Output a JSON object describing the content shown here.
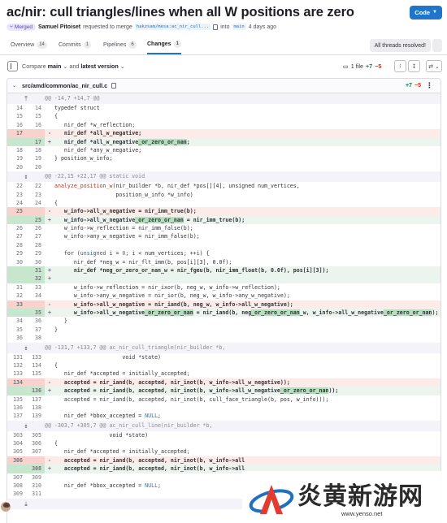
{
  "header": {
    "title": "ac/nir: cull triangles/lines when all W positions are zero",
    "code_button": "Code"
  },
  "meta": {
    "status": "Merged",
    "author": "Samuel Pitoiset",
    "action": "requested to merge",
    "source_branch": "hakzsam/mesa:ac_nir_cull...",
    "into": "into",
    "target_branch": "main",
    "time": "4 days ago"
  },
  "tabs": [
    {
      "label": "Overview",
      "count": "14"
    },
    {
      "label": "Commits",
      "count": "1"
    },
    {
      "label": "Pipelines",
      "count": "6"
    },
    {
      "label": "Changes",
      "count": "1"
    }
  ],
  "threads_button": "All threads resolved!",
  "toolbar": {
    "compare_label": "Compare",
    "base": "main",
    "and_label": "and",
    "head": "latest version",
    "files_count": "1 file",
    "additions": "+7",
    "deletions": "−5"
  },
  "file": {
    "path": "src/amd/common/ac_nir_cull.c",
    "additions": "+7",
    "deletions": "−5"
  },
  "colors": {
    "accent": "#1f75cb",
    "added": "#108548",
    "removed": "#dd2b0e"
  },
  "diff": [
    {
      "t": "hunk",
      "text": "@@ -14,7 +14,7 @@",
      "icon": "up"
    },
    {
      "t": "ctx",
      "o": "14",
      "n": "14",
      "code": [
        [
          "typedef struct",
          ""
        ]
      ]
    },
    {
      "t": "ctx",
      "o": "15",
      "n": "15",
      "code": [
        [
          "{",
          ""
        ]
      ]
    },
    {
      "t": "ctx",
      "o": "16",
      "n": "16",
      "code": [
        [
          "   nir_def *w_reflection;",
          ""
        ]
      ]
    },
    {
      "t": "del",
      "o": "17",
      "n": "",
      "code": [
        [
          "   nir_def *all_w_negative;",
          ""
        ]
      ]
    },
    {
      "t": "add",
      "o": "",
      "n": "17",
      "code": [
        [
          "   nir_def *all_w_negative",
          ""
        ],
        [
          "_or_zero_or_nan",
          "hl-a"
        ],
        [
          ";",
          ""
        ]
      ]
    },
    {
      "t": "ctx",
      "o": "18",
      "n": "18",
      "code": [
        [
          "   nir_def *any_w_negative;",
          ""
        ]
      ]
    },
    {
      "t": "ctx",
      "o": "19",
      "n": "19",
      "code": [
        [
          "} position_w_info;",
          ""
        ]
      ]
    },
    {
      "t": "ctx",
      "o": "20",
      "n": "20",
      "code": [
        [
          "",
          ""
        ]
      ]
    },
    {
      "t": "hunk",
      "text": "@@ -22,15 +22,17 @@ static void",
      "icon": "both"
    },
    {
      "t": "ctx",
      "o": "22",
      "n": "22",
      "code": [
        [
          "analyze_position_w",
          "fn"
        ],
        [
          "(nir_builder *b, nir_def *pos[][4], unsigned num_vertices,",
          ""
        ]
      ]
    },
    {
      "t": "ctx",
      "o": "23",
      "n": "23",
      "code": [
        [
          "                   position_w_info *w_info)",
          ""
        ]
      ]
    },
    {
      "t": "ctx",
      "o": "24",
      "n": "24",
      "code": [
        [
          "{",
          ""
        ]
      ]
    },
    {
      "t": "del",
      "o": "25",
      "n": "",
      "code": [
        [
          "   w_info->all_w_negative = nir_imm_true(b);",
          ""
        ]
      ]
    },
    {
      "t": "add",
      "o": "",
      "n": "25",
      "code": [
        [
          "   w_info->all_w_negative",
          ""
        ],
        [
          "_or_zero_or_nan",
          "hl-a"
        ],
        [
          " = nir_imm_true(b);",
          ""
        ]
      ]
    },
    {
      "t": "ctx",
      "o": "26",
      "n": "26",
      "code": [
        [
          "   w_info->w_reflection = nir_imm_false(b);",
          ""
        ]
      ]
    },
    {
      "t": "ctx",
      "o": "27",
      "n": "27",
      "code": [
        [
          "   w_info->any_w_negative = nir_imm_false(b);",
          ""
        ]
      ]
    },
    {
      "t": "ctx",
      "o": "28",
      "n": "28",
      "code": [
        [
          "",
          ""
        ]
      ]
    },
    {
      "t": "ctx",
      "o": "29",
      "n": "29",
      "code": [
        [
          "   for (",
          ""
        ],
        [
          "unsigned",
          "kw"
        ],
        [
          " i = ",
          ""
        ],
        [
          "0",
          "nm"
        ],
        [
          "; i < num_vertices; ++i) {",
          ""
        ]
      ]
    },
    {
      "t": "ctx",
      "o": "30",
      "n": "30",
      "code": [
        [
          "      nir_def *neg_w = nir_flt_imm(b, pos[i][3], 0.0f);",
          ""
        ]
      ]
    },
    {
      "t": "add",
      "o": "",
      "n": "31",
      "code": [
        [
          "      nir_def *neg_or_zero_or_nan_w = nir_fgeu(b, nir_imm_float(b, 0.0f), pos[i][3]);",
          ""
        ]
      ]
    },
    {
      "t": "add",
      "o": "",
      "n": "32",
      "code": [
        [
          "",
          ""
        ]
      ]
    },
    {
      "t": "ctx",
      "o": "31",
      "n": "33",
      "code": [
        [
          "      w_info->w_reflection = nir_ixor(b, neg_w, w_info->w_reflection);",
          ""
        ]
      ]
    },
    {
      "t": "ctx",
      "o": "32",
      "n": "34",
      "code": [
        [
          "      w_info->any_w_negative = nir_ior(b, neg_w, w_info->any_w_negative);",
          ""
        ]
      ]
    },
    {
      "t": "del",
      "o": "33",
      "n": "",
      "code": [
        [
          "      w_info->all_w_negative = nir_iand(b, neg_w, w_info->all_w_negative);",
          ""
        ]
      ]
    },
    {
      "t": "add",
      "o": "",
      "n": "35",
      "code": [
        [
          "      w_info->all_w_negative",
          ""
        ],
        [
          "_or_zero_or_nan",
          "hl-a"
        ],
        [
          " = nir_iand(b, neg",
          ""
        ],
        [
          "_or_zero_or_nan",
          "hl-a"
        ],
        [
          "_w, w_info->all_w_negative",
          ""
        ],
        [
          "_or_zero_or_nan",
          "hl-a"
        ],
        [
          ");",
          ""
        ]
      ]
    },
    {
      "t": "ctx",
      "o": "34",
      "n": "36",
      "code": [
        [
          "   }",
          ""
        ]
      ]
    },
    {
      "t": "ctx",
      "o": "35",
      "n": "37",
      "code": [
        [
          "}",
          ""
        ]
      ]
    },
    {
      "t": "ctx",
      "o": "36",
      "n": "38",
      "code": [
        [
          "",
          ""
        ]
      ]
    },
    {
      "t": "hunk",
      "text": "@@ -131,7 +133,7 @@ ac_nir_cull_triangle(nir_builder *b,",
      "icon": "both"
    },
    {
      "t": "ctx",
      "o": "131",
      "n": "133",
      "code": [
        [
          "                     void *state)",
          ""
        ]
      ]
    },
    {
      "t": "ctx",
      "o": "132",
      "n": "134",
      "code": [
        [
          "{",
          ""
        ]
      ]
    },
    {
      "t": "ctx",
      "o": "133",
      "n": "135",
      "code": [
        [
          "   nir_def *accepted = initially_accepted;",
          ""
        ]
      ]
    },
    {
      "t": "del",
      "o": "134",
      "n": "",
      "code": [
        [
          "   accepted = nir_iand(b, accepted, nir_inot(b, w_info->all_w_negative));",
          ""
        ]
      ]
    },
    {
      "t": "add",
      "o": "",
      "n": "136",
      "code": [
        [
          "   accepted = nir_iand(b, accepted, nir_inot(b, w_info->all_w_negative",
          ""
        ],
        [
          "_or_zero_or_nan",
          "hl-a"
        ],
        [
          "));",
          ""
        ]
      ]
    },
    {
      "t": "ctx",
      "o": "135",
      "n": "137",
      "code": [
        [
          "   accepted = nir_iand(b, accepted, nir_inot(b, cull_face_triangle(b, pos, w_info)));",
          ""
        ]
      ]
    },
    {
      "t": "ctx",
      "o": "136",
      "n": "138",
      "code": [
        [
          "",
          ""
        ]
      ]
    },
    {
      "t": "ctx",
      "o": "137",
      "n": "139",
      "code": [
        [
          "   nir_def *bbox_accepted = ",
          ""
        ],
        [
          "NULL",
          "nm"
        ],
        [
          ";",
          ""
        ]
      ]
    },
    {
      "t": "hunk",
      "text": "@@ -303,7 +305,7 @@ ac_nir_cull_line(nir_builder *b,",
      "icon": "both"
    },
    {
      "t": "ctx",
      "o": "303",
      "n": "305",
      "code": [
        [
          "                 void *state)",
          ""
        ]
      ]
    },
    {
      "t": "ctx",
      "o": "304",
      "n": "306",
      "code": [
        [
          "{",
          ""
        ]
      ]
    },
    {
      "t": "ctx",
      "o": "305",
      "n": "307",
      "code": [
        [
          "   nir_def *accepted = initially_accepted;",
          ""
        ]
      ]
    },
    {
      "t": "del",
      "o": "306",
      "n": "",
      "code": [
        [
          "   accepted = nir_iand(b, accepted, nir_inot(b, w_info->all",
          ""
        ]
      ]
    },
    {
      "t": "add",
      "o": "",
      "n": "308",
      "code": [
        [
          "   accepted = nir_iand(b, accepted, nir_inot(b, w_info->all",
          ""
        ]
      ]
    },
    {
      "t": "ctx",
      "o": "307",
      "n": "309",
      "code": [
        [
          "",
          ""
        ]
      ]
    },
    {
      "t": "ctx",
      "o": "308",
      "n": "310",
      "code": [
        [
          "   nir_def *bbox_accepted = ",
          ""
        ],
        [
          "NULL",
          "nm"
        ],
        [
          ";",
          ""
        ]
      ]
    },
    {
      "t": "ctx",
      "o": "309",
      "n": "311",
      "code": [
        [
          "",
          ""
        ]
      ]
    },
    {
      "t": "hunk",
      "text": "",
      "icon": "down"
    }
  ],
  "watermark": {
    "name": "炎黄新游网",
    "url": "www.yenso.net"
  }
}
